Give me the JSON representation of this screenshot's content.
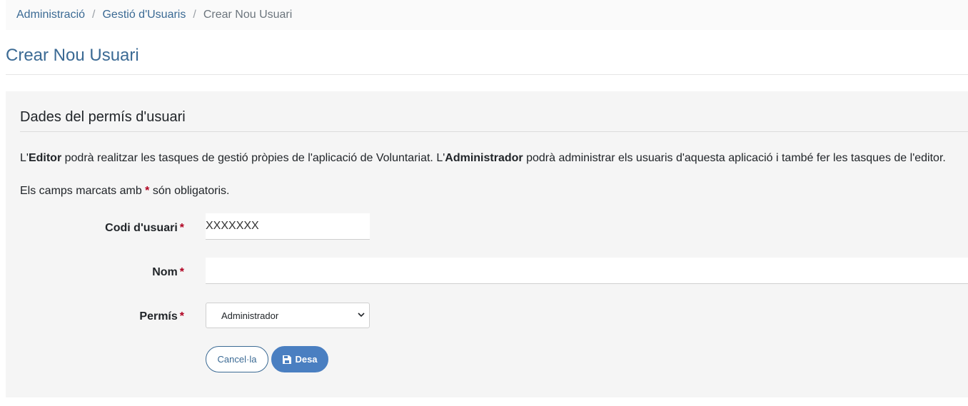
{
  "breadcrumb": {
    "items": [
      "Administració",
      "Gestió d'Usuaris"
    ],
    "current": "Crear Nou Usuari",
    "separator": "/"
  },
  "page": {
    "title": "Crear Nou Usuari"
  },
  "panel": {
    "heading": "Dades del permís d'usuari",
    "intro": {
      "part1": "L'",
      "editor": "Editor",
      "part2": " podrà realitzar les tasques de gestió pròpies de l'aplicació de Voluntariat. L'",
      "administrator": "Administrador",
      "part3": " podrà administrar els usuaris d'aquesta aplicació i també fer les tasques de l'editor."
    },
    "required_note": {
      "before": "Els camps marcats amb ",
      "star": "*",
      "after": " són obligatoris."
    }
  },
  "form": {
    "code_label": "Codi d'usuari",
    "code_value": "XXXXXXX",
    "name_label": "Nom",
    "name_value": "",
    "permission_label": "Permís",
    "permission_selected": "Administrador",
    "required_star": "*"
  },
  "actions": {
    "cancel_label": "Cancel·la",
    "save_label": "Desa",
    "save_icon": "save-icon"
  },
  "colors": {
    "accent": "#3b6a94",
    "primary_button": "#4a7fc1",
    "required": "#b00020",
    "panel_bg": "#f5f5f5"
  }
}
